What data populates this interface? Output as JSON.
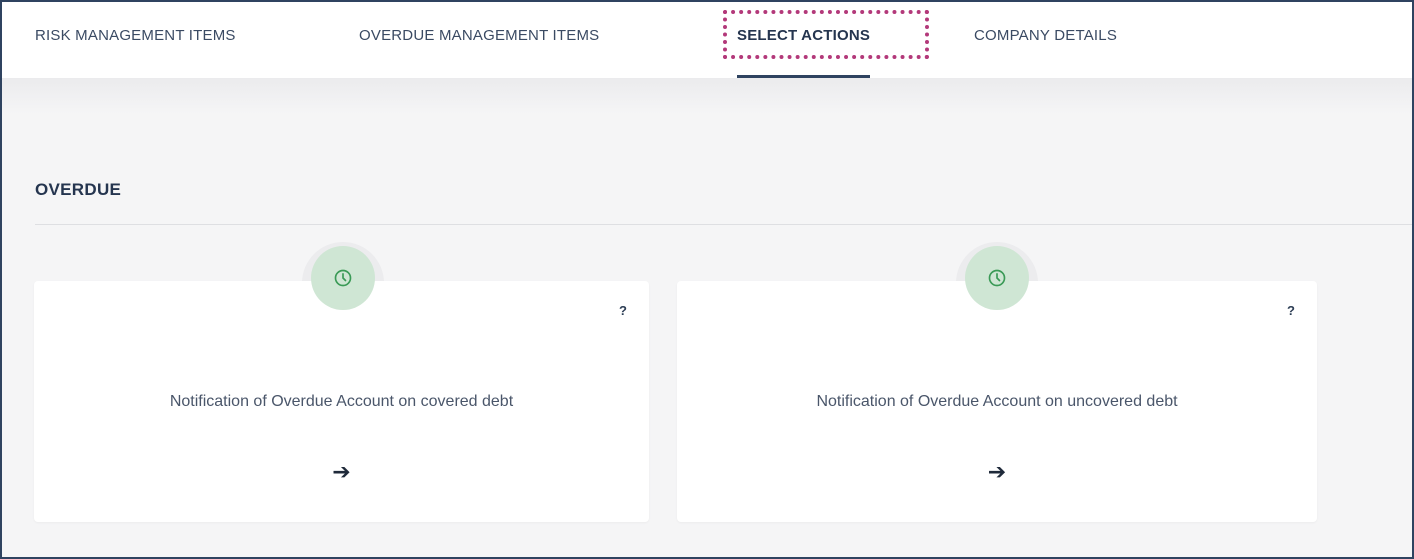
{
  "tabs": [
    {
      "label": "RISK MANAGEMENT ITEMS",
      "active": false
    },
    {
      "label": "OVERDUE MANAGEMENT ITEMS",
      "active": false
    },
    {
      "label": "SELECT ACTIONS",
      "active": true
    },
    {
      "label": "COMPANY DETAILS",
      "active": false
    }
  ],
  "section": {
    "title": "OVERDUE"
  },
  "cards": [
    {
      "icon": "clock-icon",
      "help": "?",
      "title": "Notification of Overdue Account on covered debt",
      "arrow": "➔"
    },
    {
      "icon": "clock-icon",
      "help": "?",
      "title": "Notification of Overdue Account on uncovered debt",
      "arrow": "➔"
    }
  ],
  "colors": {
    "accent": "#2f4360",
    "highlight": "#b3397a",
    "badge_bg": "#cfe6d4",
    "badge_icon": "#3a9a56",
    "page_bg": "#f5f5f6"
  }
}
